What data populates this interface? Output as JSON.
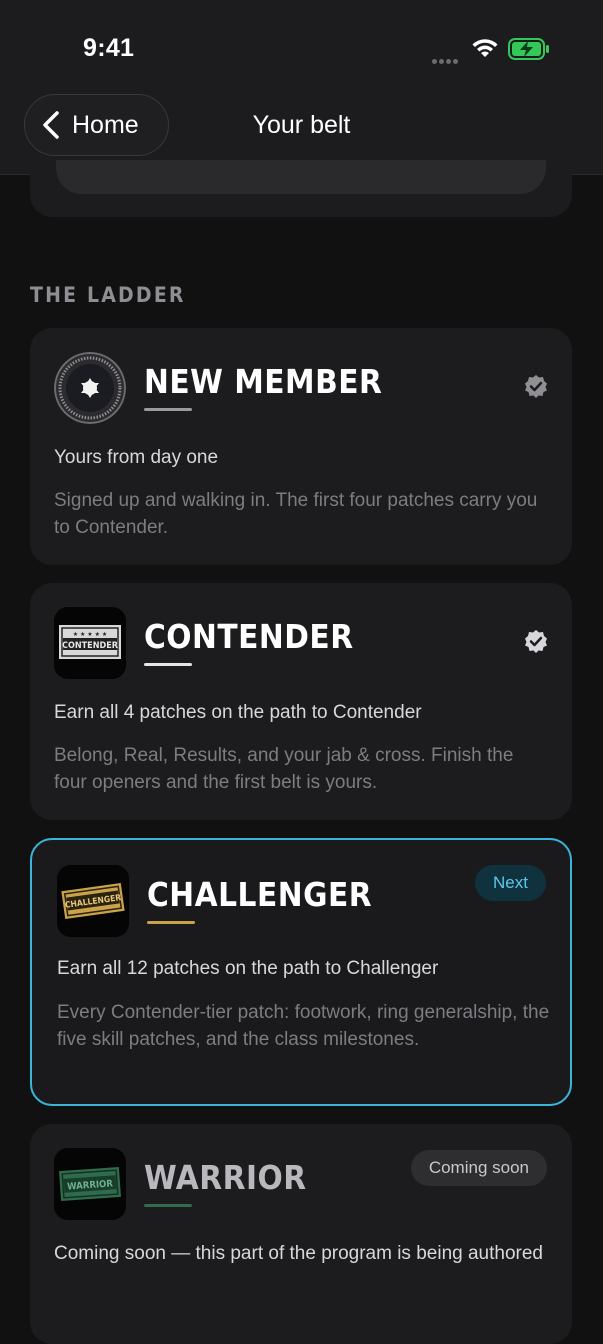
{
  "status_bar": {
    "time": "9:41"
  },
  "nav": {
    "back_label": "Home",
    "title": "Your belt"
  },
  "section_title": "THE LADDER",
  "cards": [
    {
      "title": "NEW MEMBER",
      "subtitle": "Yours from day one",
      "description": "Signed up and walking in. The first four patches carry you to Contender.",
      "status": "earned",
      "accent": "#9a9aa0"
    },
    {
      "title": "CONTENDER",
      "badge_text": "CONTENDER",
      "subtitle": "Earn all 4 patches on the path to Contender",
      "description": "Belong, Real, Results, and your jab & cross. Finish the four openers and the first belt is yours.",
      "status": "earned",
      "accent": "#e6e6e6"
    },
    {
      "title": "CHALLENGER",
      "badge_text": "CHALLENGER",
      "pill": "Next",
      "subtitle": "Earn all 12 patches on the path to Challenger",
      "description": "Every Contender-tier patch: footwork, ring generalship, the five skill patches, and the class milestones.",
      "status": "next",
      "accent": "#c9a24a"
    },
    {
      "title": "WARRIOR",
      "badge_text": "WARRIOR",
      "pill": "Coming soon",
      "subtitle": "Coming soon — this part of the program is being authored",
      "status": "coming-soon",
      "accent": "#2f6b4c"
    }
  ],
  "colors": {
    "highlight_border": "#3ab6d8",
    "background": "#111112",
    "card": "#1c1c1e"
  }
}
